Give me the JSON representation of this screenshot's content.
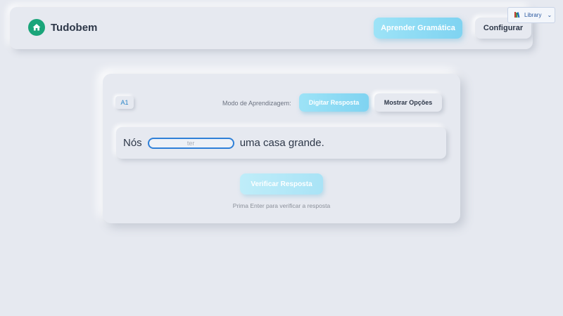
{
  "header": {
    "brand": "Tudobem",
    "grammar_button": "Aprender Gramática",
    "config_button": "Configurar"
  },
  "library": {
    "label": "Library"
  },
  "exercise": {
    "level": "A1",
    "mode_label": "Modo de Aprendizagem:",
    "mode_type_button": "Digitar Resposta",
    "mode_options_button": "Mostrar Opções",
    "sentence_before": "Nós",
    "sentence_after": "uma casa grande.",
    "input_placeholder": "ter",
    "input_value": "",
    "verify_button": "Verificar Resposta",
    "hint": "Prima Enter para verificar a resposta"
  },
  "colors": {
    "background": "#e6e9f0",
    "accent": "#7fd3f1",
    "brand_green": "#1aa57a",
    "input_border": "#2f80d8"
  }
}
